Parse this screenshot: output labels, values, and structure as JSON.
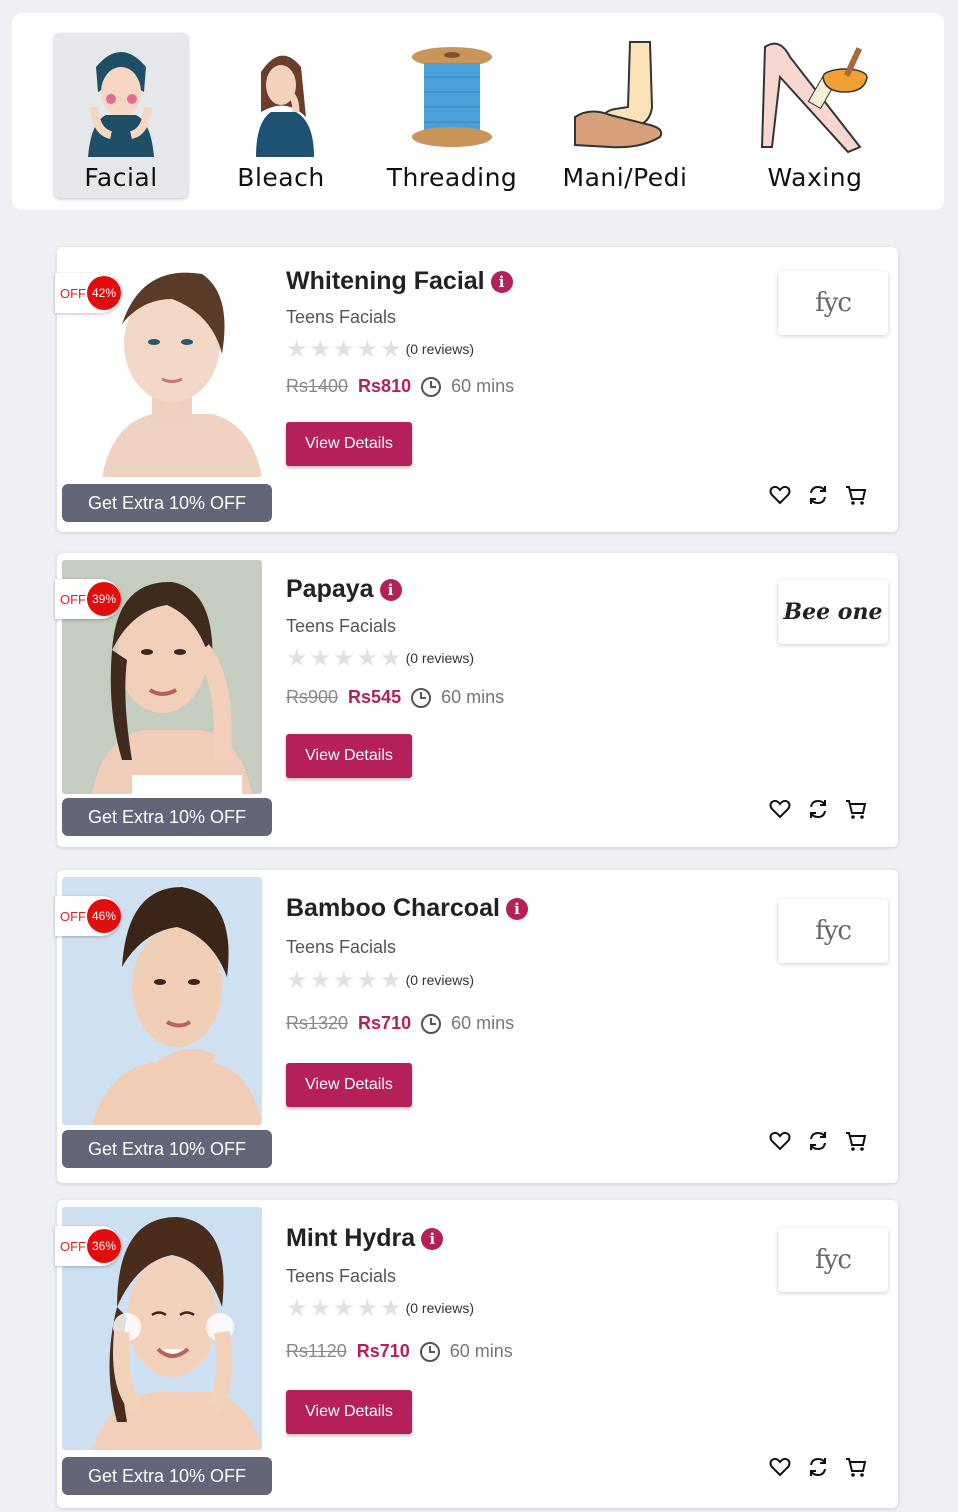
{
  "categories": [
    {
      "label": "Facial",
      "active": true,
      "icon": "facial-icon"
    },
    {
      "label": "Bleach",
      "active": false,
      "icon": "bleach-icon"
    },
    {
      "label": "Threading",
      "active": false,
      "icon": "threading-icon"
    },
    {
      "label": "Mani/Pedi",
      "active": false,
      "icon": "mani-pedi-icon"
    },
    {
      "label": "Waxing",
      "active": false,
      "icon": "waxing-icon"
    }
  ],
  "colors": {
    "accent": "#b5205a",
    "badge": "#e20e0e",
    "extra_bar": "#626676"
  },
  "products": [
    {
      "title": "Whitening Facial",
      "category": "Teens Facials",
      "reviews": "(0 reviews)",
      "old_price": "Rs1400",
      "new_price": "Rs810",
      "duration": "60 mins",
      "off_label": "OFF",
      "discount": "42%",
      "extra": "Get Extra 10% OFF",
      "button": "View Details",
      "brand": "fyc",
      "brand_icon": "fyc-logo",
      "rating": 0
    },
    {
      "title": "Papaya",
      "category": "Teens Facials",
      "reviews": "(0 reviews)",
      "old_price": "Rs900",
      "new_price": "Rs545",
      "duration": "60 mins",
      "off_label": "OFF",
      "discount": "39%",
      "extra": "Get Extra 10% OFF",
      "button": "View Details",
      "brand": "Bee one",
      "brand_icon": "beeone-logo",
      "rating": 0
    },
    {
      "title": "Bamboo Charcoal",
      "category": "Teens Facials",
      "reviews": "(0 reviews)",
      "old_price": "Rs1320",
      "new_price": "Rs710",
      "duration": "60 mins",
      "off_label": "OFF",
      "discount": "46%",
      "extra": "Get Extra 10% OFF",
      "button": "View Details",
      "brand": "fyc",
      "brand_icon": "fyc-logo",
      "rating": 0
    },
    {
      "title": "Mint Hydra",
      "category": "Teens Facials",
      "reviews": "(0 reviews)",
      "old_price": "Rs1120",
      "new_price": "Rs710",
      "duration": "60 mins",
      "off_label": "OFF",
      "discount": "36%",
      "extra": "Get Extra 10% OFF",
      "button": "View Details",
      "brand": "fyc",
      "brand_icon": "fyc-logo",
      "rating": 0
    }
  ]
}
